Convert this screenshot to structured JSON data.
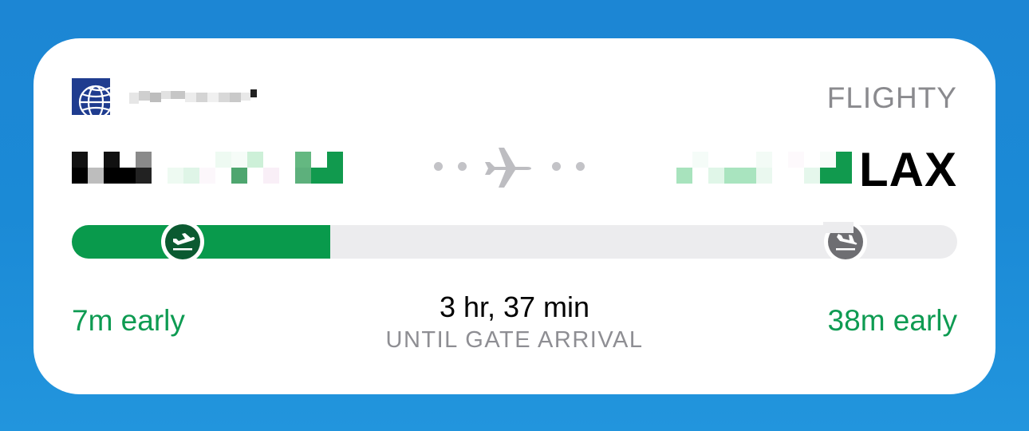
{
  "widget": {
    "brand": "FLIGHTY",
    "destination_code": "LAX",
    "time_remaining": "3 hr, 37 min",
    "time_remaining_label": "UNTIL GATE ARRIVAL",
    "departure_status": "7m early",
    "arrival_status": "38m early",
    "progress_fraction": 0.292,
    "icons": {
      "airline_logo": "united-globe-logo",
      "route_plane": "airplane-icon",
      "departure": "takeoff-icon",
      "arrival": "landing-icon"
    },
    "colors": {
      "accent_green": "#099a4c",
      "status_green": "#0e9b52",
      "departure_knob": "#0b5a31",
      "arrival_knob": "#6e6e72",
      "track": "#ececee",
      "background_blue": "#1b8ad6"
    }
  }
}
